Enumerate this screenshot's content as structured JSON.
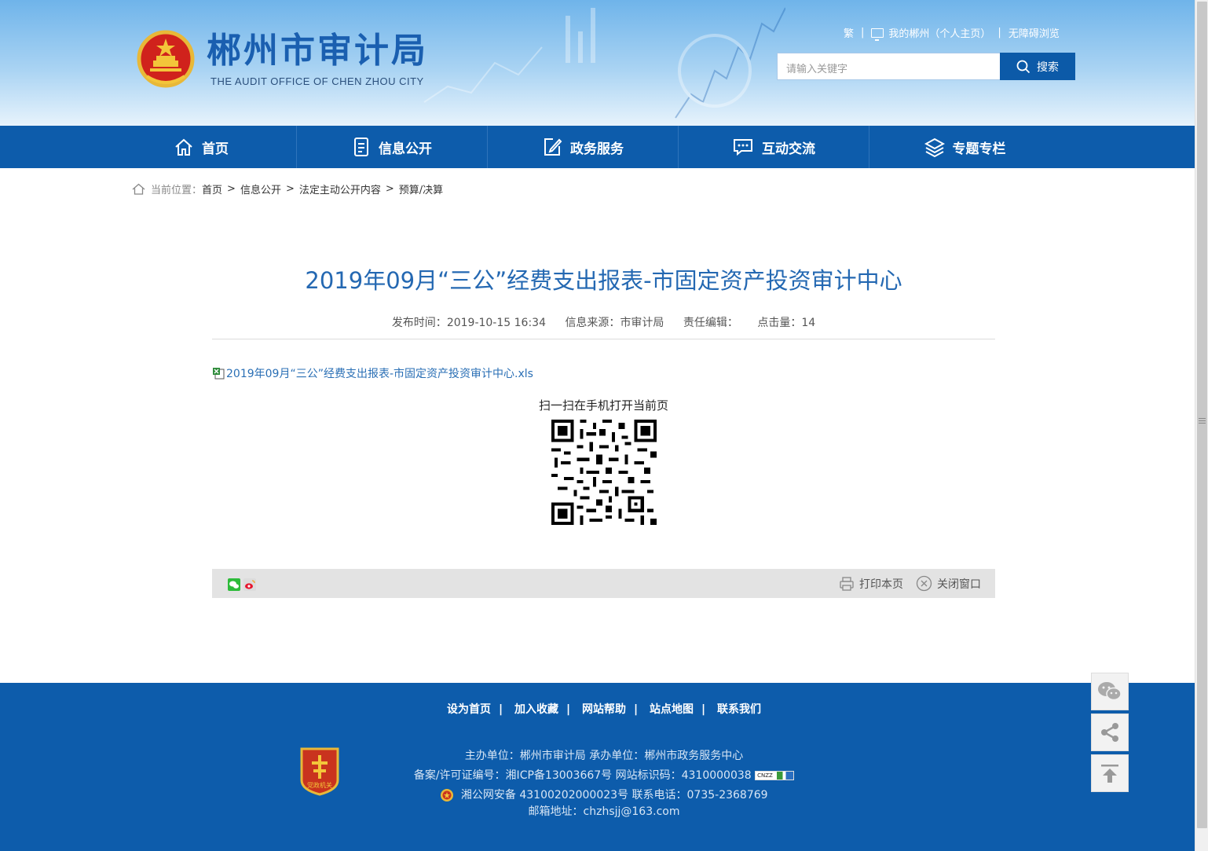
{
  "header": {
    "site_title": "郴州市审计局",
    "site_subtitle": "THE AUDIT OFFICE OF CHEN ZHOU CITY",
    "top_links": {
      "traditional": "繁",
      "my_chenzhou": "我的郴州（个人主页）",
      "accessibility": "无障碍浏览"
    },
    "search": {
      "placeholder": "请输入关键字",
      "button_label": "搜索"
    }
  },
  "nav": {
    "items": [
      {
        "label": "首页",
        "icon": "home-icon"
      },
      {
        "label": "信息公开",
        "icon": "document-icon"
      },
      {
        "label": "政务服务",
        "icon": "edit-icon"
      },
      {
        "label": "互动交流",
        "icon": "chat-icon"
      },
      {
        "label": "专题专栏",
        "icon": "layers-icon"
      }
    ]
  },
  "breadcrumb": {
    "prefix": "当前位置：",
    "items": [
      "首页",
      "信息公开",
      "法定主动公开内容",
      "预算/决算"
    ]
  },
  "article": {
    "title": "2019年09月“三公”经费支出报表-市固定资产投资审计中心",
    "publish_label": "发布时间：",
    "publish_time": "2019-10-15 16:34",
    "source_label": "信息来源：",
    "source": "市审计局",
    "editor_label": "责任编辑：",
    "editor": "",
    "hits_label": "点击量：",
    "hits": "14",
    "attachment": "2019年09月“三公”经费支出报表-市固定资产投资审计中心.xls",
    "qr_caption": "扫一扫在手机打开当前页"
  },
  "share": {
    "print_label": "打印本页",
    "close_label": "关闭窗口"
  },
  "footer": {
    "links": [
      "设为首页",
      "加入收藏",
      "网站帮助",
      "站点地图",
      "联系我们"
    ],
    "sponsor_line": "主办单位：郴州市审计局   承办单位：郴州市政务服务中心",
    "icp_line": "备案/许可证编号：湘ICP备13003667号   网站标识码：4310000038",
    "cnzz_label": "CNZZ",
    "police_line": "湘公网安备 43100202000023号   联系电话：0735-2368769",
    "email_line": "邮箱地址：chzhsjj@163.com",
    "badge_text": "党政机关"
  },
  "colors": {
    "primary_blue": "#0d5cab",
    "title_blue": "#2468b2",
    "link_blue": "#2a6fb5"
  }
}
